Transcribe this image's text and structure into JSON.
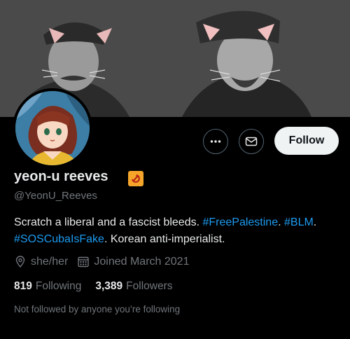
{
  "profile": {
    "display_name": "yeon-u reeves",
    "badge_icon": "hammer-sickle-icon",
    "handle": "@YeonU_Reeves",
    "bio": {
      "text1": "Scratch a liberal and a fascist bleeds. ",
      "tag1": "#FreePalestine",
      "text2": ". ",
      "tag2": "#BLM",
      "text3": ". ",
      "tag3": "#SOSCubaIsFake",
      "text4": ". Korean anti-imperialist."
    },
    "pronouns": "she/her",
    "joined": "Joined March 2021",
    "following_count": "819",
    "following_label": "Following",
    "followers_count": "3,389",
    "followers_label": "Followers",
    "followed_by": "Not followed by anyone you’re following"
  },
  "actions": {
    "more_icon": "more-icon",
    "message_icon": "envelope-icon",
    "follow_label": "Follow"
  },
  "colors": {
    "background": "#000000",
    "accent": "#1d9bf0",
    "muted": "#71767b",
    "badge": "#f4a52a"
  }
}
